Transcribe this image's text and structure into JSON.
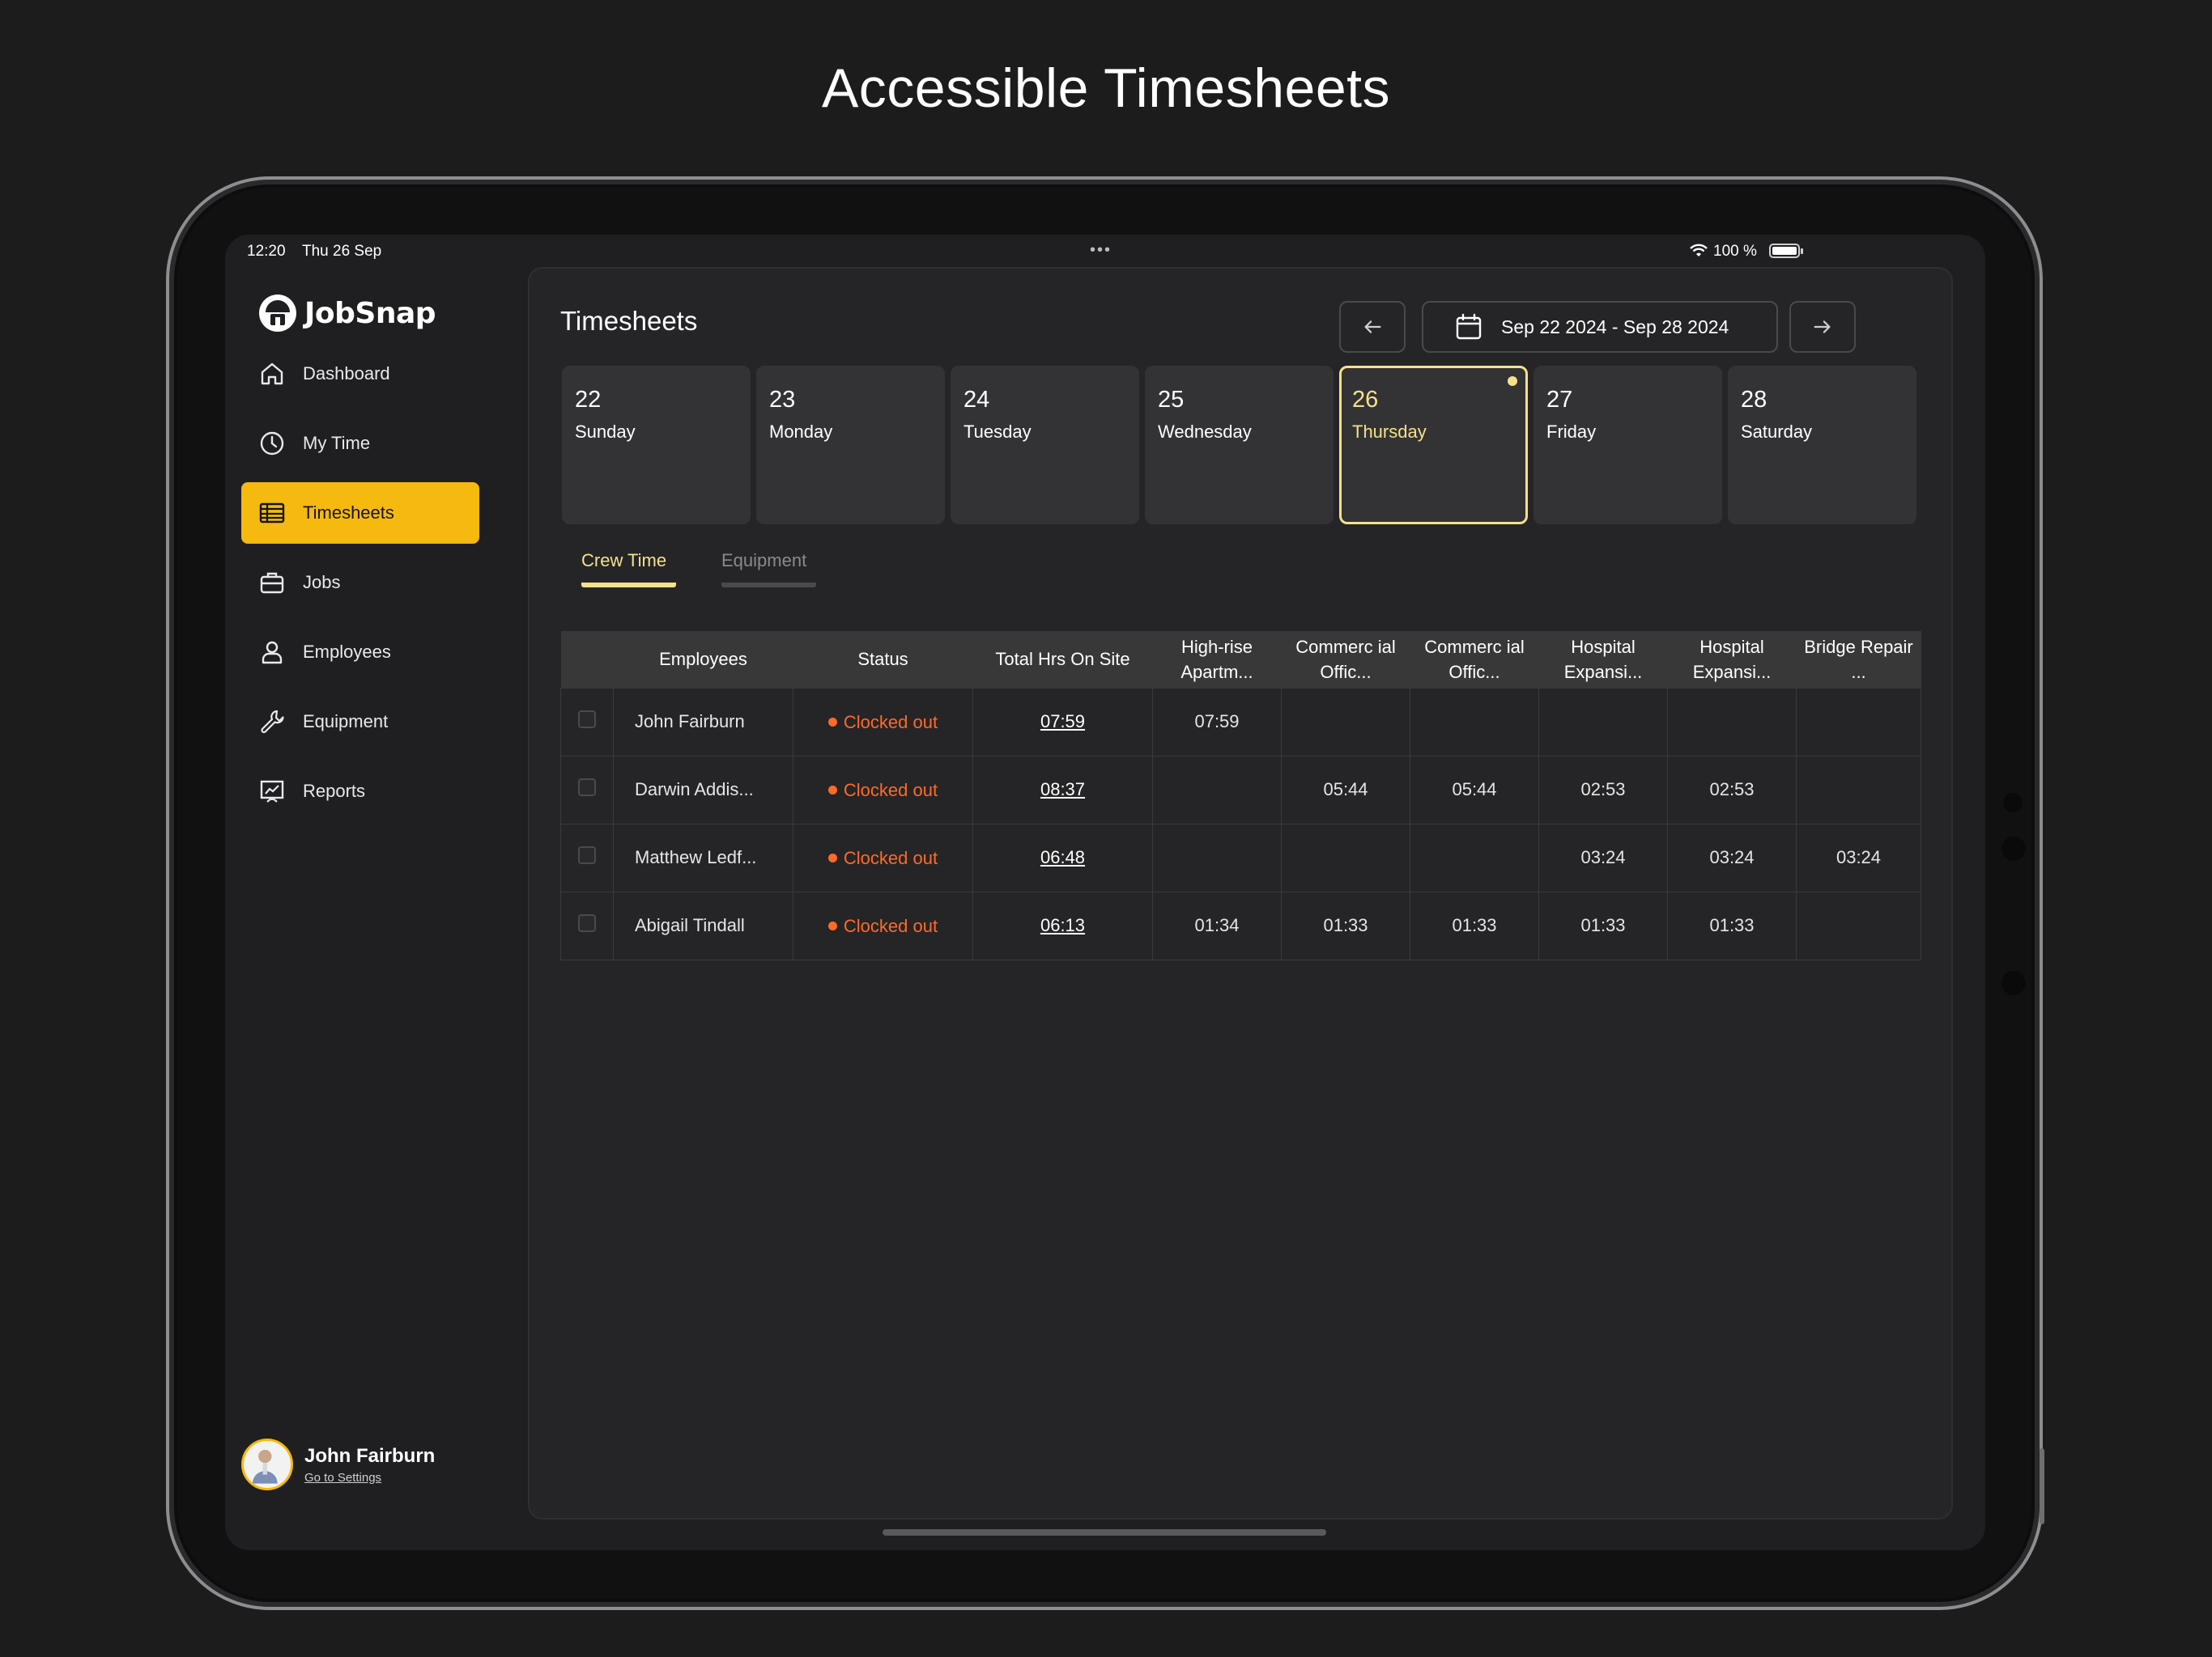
{
  "page_title": "Accessible Timesheets",
  "status_bar": {
    "time": "12:20",
    "date": "Thu 26 Sep",
    "battery": "100 %"
  },
  "app": {
    "name": "JobSnap"
  },
  "sidebar": {
    "items": [
      {
        "label": "Dashboard",
        "icon": "home-icon"
      },
      {
        "label": "My Time",
        "icon": "clock-icon"
      },
      {
        "label": "Timesheets",
        "icon": "table-icon",
        "active": true
      },
      {
        "label": "Jobs",
        "icon": "briefcase-icon"
      },
      {
        "label": "Employees",
        "icon": "person-icon"
      },
      {
        "label": "Equipment",
        "icon": "wrench-icon"
      },
      {
        "label": "Reports",
        "icon": "chart-icon"
      }
    ]
  },
  "user": {
    "name": "John Fairburn",
    "settings_link": "Go to Settings"
  },
  "main": {
    "title": "Timesheets",
    "date_range": "Sep 22 2024 - Sep 28 2024",
    "days": [
      {
        "num": "22",
        "name": "Sunday"
      },
      {
        "num": "23",
        "name": "Monday"
      },
      {
        "num": "24",
        "name": "Tuesday"
      },
      {
        "num": "25",
        "name": "Wednesday"
      },
      {
        "num": "26",
        "name": "Thursday",
        "active": true
      },
      {
        "num": "27",
        "name": "Friday"
      },
      {
        "num": "28",
        "name": "Saturday"
      }
    ],
    "tabs": [
      {
        "label": "Crew Time",
        "active": true
      },
      {
        "label": "Equipment"
      }
    ],
    "table": {
      "headers": [
        "Employees",
        "Status",
        "Total Hrs On Site",
        "High-rise Apartm...",
        "Commerc ial Offic...",
        "Commerc ial Offic...",
        "Hospital Expansi...",
        "Hospital Expansi...",
        "Bridge Repair ..."
      ],
      "rows": [
        {
          "employee": "John Fairburn",
          "status": "Clocked out",
          "total": "07:59",
          "cells": [
            "07:59",
            "",
            "",
            "",
            "",
            ""
          ]
        },
        {
          "employee": "Darwin Addis...",
          "status": "Clocked out",
          "total": "08:37",
          "cells": [
            "",
            "05:44",
            "05:44",
            "02:53",
            "02:53",
            ""
          ]
        },
        {
          "employee": "Matthew Ledf...",
          "status": "Clocked out",
          "total": "06:48",
          "cells": [
            "",
            "",
            "",
            "03:24",
            "03:24",
            "03:24"
          ]
        },
        {
          "employee": "Abigail Tindall",
          "status": "Clocked out",
          "total": "06:13",
          "cells": [
            "01:34",
            "01:33",
            "01:33",
            "01:33",
            "01:33",
            ""
          ]
        }
      ]
    }
  },
  "colors": {
    "accent": "#f5b90f",
    "active_day": "#f7e08c",
    "status_orange": "#ff6a2a",
    "background": "#1c1c1c"
  }
}
